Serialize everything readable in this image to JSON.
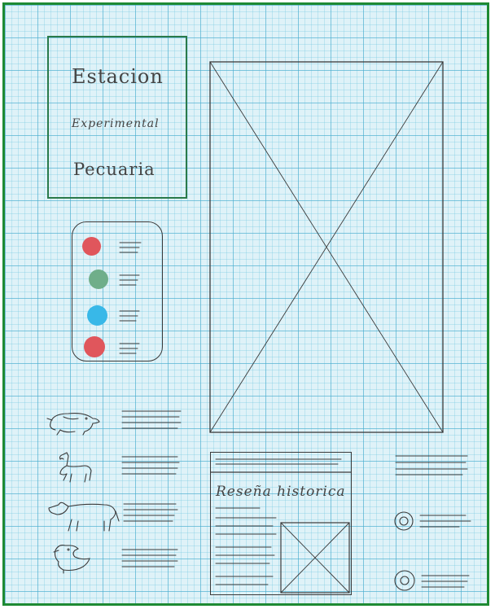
{
  "logo_box": {
    "line1": "Estacion",
    "line2": "Experimental",
    "line3": "Pecuaria",
    "border_color": "#1e8a33"
  },
  "menu_dots": [
    {
      "color": "#e0565c",
      "icon": "red-dot-icon"
    },
    {
      "color": "#6fae8a",
      "icon": "green-dot-icon"
    },
    {
      "color": "#38b8e8",
      "icon": "blue-dot-icon"
    },
    {
      "color": "#e0565c",
      "icon": "red-dot-icon"
    }
  ],
  "animals": [
    {
      "icon": "pig-icon"
    },
    {
      "icon": "llama-icon"
    },
    {
      "icon": "cow-icon"
    },
    {
      "icon": "duck-icon"
    }
  ],
  "history_card": {
    "title": "Reseña historica"
  }
}
